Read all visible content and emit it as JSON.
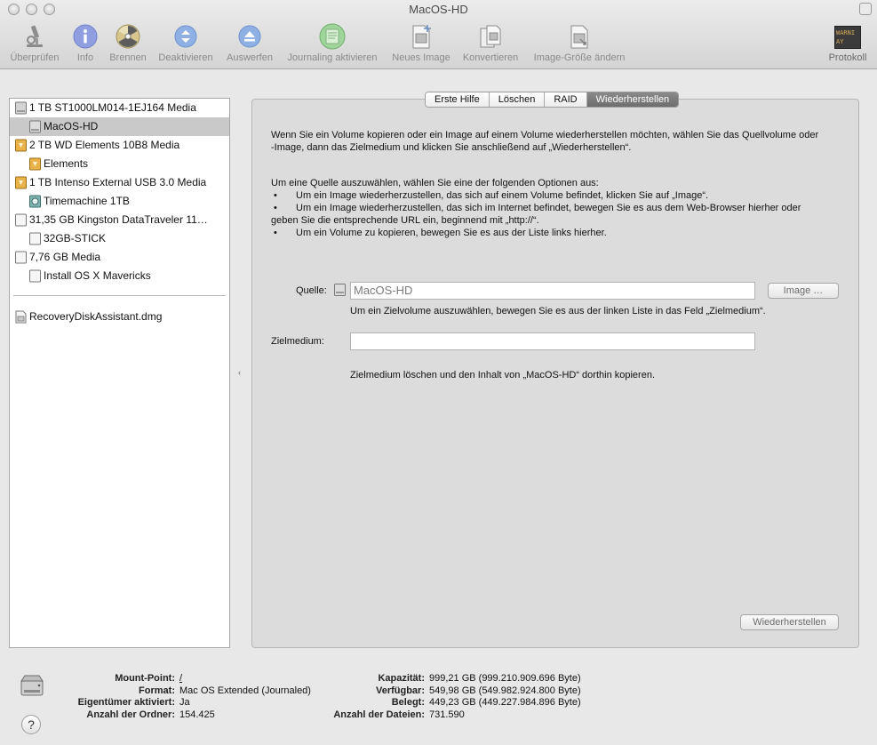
{
  "window": {
    "title": "MacOS-HD"
  },
  "toolbar": {
    "items": [
      {
        "label": "Überprüfen",
        "icon": "microscope-icon"
      },
      {
        "label": "Info",
        "icon": "info-icon"
      },
      {
        "label": "Brennen",
        "icon": "burn-icon"
      },
      {
        "label": "Deaktivieren",
        "icon": "unmount-icon"
      },
      {
        "label": "Auswerfen",
        "icon": "eject-icon"
      },
      {
        "label": "Journaling aktivieren",
        "icon": "journaling-icon"
      },
      {
        "label": "Neues Image",
        "icon": "new-image-icon"
      },
      {
        "label": "Konvertieren",
        "icon": "convert-icon"
      },
      {
        "label": "Image-Größe ändern",
        "icon": "resize-image-icon"
      },
      {
        "label": "Protokoll",
        "icon": "log-icon",
        "badge_line1": "WARNI",
        "badge_line2": "AY 7:36"
      }
    ]
  },
  "sidebar": {
    "items": [
      {
        "label": "1 TB ST1000LM014-1EJ164 Media",
        "type": "disk-internal"
      },
      {
        "label": "MacOS-HD",
        "type": "volume-internal",
        "selected": true
      },
      {
        "label": "2 TB WD Elements 10B8 Media",
        "type": "disk-external"
      },
      {
        "label": "Elements",
        "type": "volume-external"
      },
      {
        "label": "1 TB Intenso External USB 3.0 Media",
        "type": "disk-external"
      },
      {
        "label": "Timemachine 1TB",
        "type": "volume-timemachine"
      },
      {
        "label": "31,35 GB Kingston DataTraveler 11…",
        "type": "disk-usb"
      },
      {
        "label": "32GB-STICK",
        "type": "volume-usb"
      },
      {
        "label": "7,76 GB Media",
        "type": "disk-usb"
      },
      {
        "label": "Install OS X Mavericks",
        "type": "volume-usb"
      }
    ],
    "images": [
      {
        "label": "RecoveryDiskAssistant.dmg",
        "type": "dmg"
      }
    ]
  },
  "tabs": [
    {
      "label": "Erste Hilfe",
      "active": false
    },
    {
      "label": "Löschen",
      "active": false
    },
    {
      "label": "RAID",
      "active": false
    },
    {
      "label": "Wiederherstellen",
      "active": true
    }
  ],
  "restore": {
    "intro": "Wenn Sie ein Volume kopieren oder ein Image auf einem Volume wiederherstellen möchten, wählen Sie das Quellvolume oder -Image, dann das Zielmedium und klicken Sie anschließend auf „Wiederherstellen“.",
    "options_title": "Um eine Quelle auszuwählen, wählen Sie eine der folgenden Optionen aus:",
    "bullet_char": "•",
    "bullets": [
      "Um ein Image wiederherzustellen, das sich auf einem Volume befindet, klicken Sie auf „Image“.",
      "Um ein Image wiederherzustellen, das sich im Internet befindet, bewegen Sie es aus dem Web-Browser hierher oder geben Sie die entsprechende URL ein, beginnend mit „http://“.",
      "Um ein Volume zu kopieren, bewegen Sie es aus der Liste links hierher."
    ],
    "source_label": "Quelle:",
    "source_value": "MacOS-HD",
    "image_button": "Image …",
    "source_hint": "Um ein Zielvolume auszuwählen, bewegen Sie es aus der linken Liste in das Feld „Zielmedium“.",
    "target_label": "Zielmedium:",
    "target_value": "",
    "summary": "Zielmedium löschen und den Inhalt von „MacOS-HD“ dorthin kopieren.",
    "restore_button": "Wiederherstellen"
  },
  "info": {
    "left": [
      {
        "key": "Mount-Point:",
        "value": "/",
        "link": true
      },
      {
        "key": "Format:",
        "value": "Mac OS Extended (Journaled)"
      },
      {
        "key": "Eigentümer aktiviert:",
        "value": "Ja"
      },
      {
        "key": "Anzahl der Ordner:",
        "value": "154.425"
      }
    ],
    "right": [
      {
        "key": "Kapazität:",
        "value": "999,21 GB (999.210.909.696 Byte)"
      },
      {
        "key": "Verfügbar:",
        "value": "549,98 GB (549.982.924.800 Byte)"
      },
      {
        "key": "Belegt:",
        "value": "449,23 GB (449.227.984.896 Byte)"
      },
      {
        "key": "Anzahl der Dateien:",
        "value": "731.590"
      }
    ],
    "help_label": "?"
  }
}
